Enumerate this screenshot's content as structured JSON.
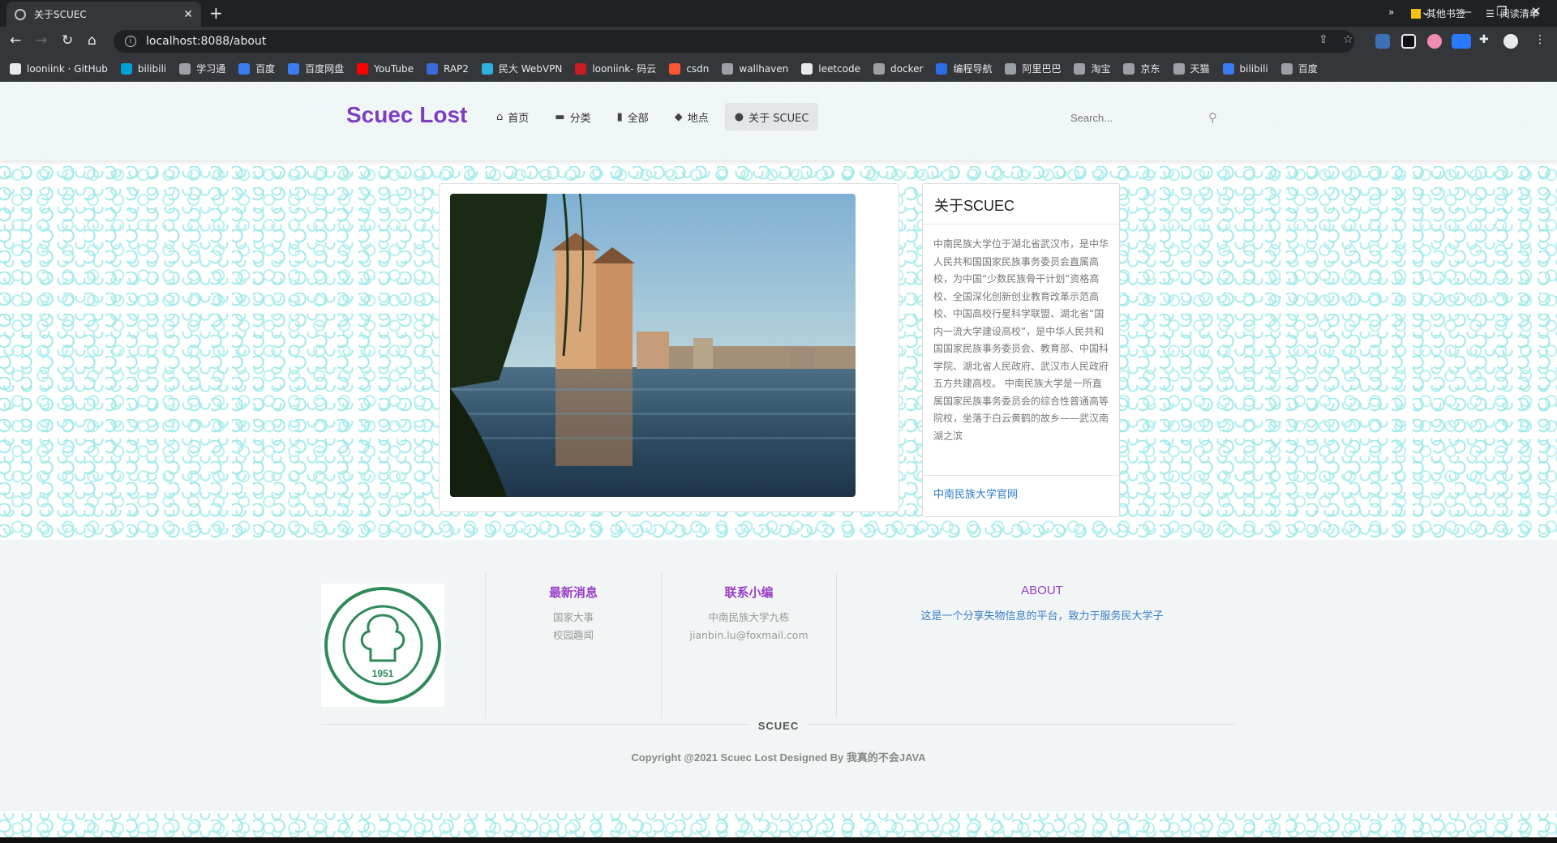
{
  "browser": {
    "tab_title": "关于SCUEC",
    "tab_close": "✕",
    "new_tab": "+",
    "url": "localhost:8088/about",
    "bookmarks": [
      {
        "label": "looniink · GitHub",
        "color": "#e8eaed"
      },
      {
        "label": "bilibili",
        "color": "#00a1d6"
      },
      {
        "label": "学习通",
        "color": "#9aa0a6"
      },
      {
        "label": "百度",
        "color": "#3b7cf0"
      },
      {
        "label": "百度网盘",
        "color": "#3b7cf0"
      },
      {
        "label": "YouTube",
        "color": "#ff0000"
      },
      {
        "label": "RAP2",
        "color": "#3b6ad9"
      },
      {
        "label": "民大 WebVPN",
        "color": "#2bb0e0"
      },
      {
        "label": "looniink- 码云",
        "color": "#c71d23"
      },
      {
        "label": "csdn",
        "color": "#fc5531"
      },
      {
        "label": "wallhaven",
        "color": "#9aa0a6"
      },
      {
        "label": "leetcode",
        "color": "#e8eaed"
      },
      {
        "label": "docker",
        "color": "#9aa0a6"
      },
      {
        "label": "编程导航",
        "color": "#2b6de6"
      },
      {
        "label": "阿里巴巴",
        "color": "#9aa0a6"
      },
      {
        "label": "淘宝",
        "color": "#9aa0a6"
      },
      {
        "label": "京东",
        "color": "#9aa0a6"
      },
      {
        "label": "天猫",
        "color": "#9aa0a6"
      },
      {
        "label": "bilibili",
        "color": "#3b7cf0"
      },
      {
        "label": "百度",
        "color": "#9aa0a6"
      }
    ],
    "more_bookmarks": "»",
    "other_bookmarks": "其他书签",
    "reading_list": "阅读清单"
  },
  "site": {
    "logo": "Scuec Lost",
    "nav": [
      {
        "icon": "⌂",
        "label": "首页"
      },
      {
        "icon": "▬",
        "label": "分类"
      },
      {
        "icon": "▮",
        "label": "全部"
      },
      {
        "icon": "◆",
        "label": "地点"
      },
      {
        "icon": "●",
        "label": "关于 SCUEC"
      }
    ],
    "search_placeholder": "Search..."
  },
  "about": {
    "title": "关于SCUEC",
    "body": "中南民族大学位于湖北省武汉市，是中华人民共和国国家民族事务委员会直属高校，为中国“少数民族骨干计划”资格高校、全国深化创新创业教育改革示范高校、中国高校行星科学联盟、湖北省“国内一流大学建设高校”，是中华人民共和国国家民族事务委员会、教育部、中国科学院、湖北省人民政府、武汉市人民政府五方共建高校。 中南民族大学是一所直属国家民族事务委员会的综合性普通高等院校，坐落于白云黄鹤的故乡——武汉南湖之滨",
    "link": "中南民族大学官网"
  },
  "footer": {
    "logo_year": "1951",
    "news": {
      "title": "最新消息",
      "items": [
        "国家大事",
        "校园趣闻"
      ]
    },
    "contact": {
      "title": "联系小编",
      "items": [
        "中南民族大学九栋",
        "jianbin.lu@foxmail.com"
      ]
    },
    "about": {
      "title": "ABOUT",
      "text": "这是一个分享失物信息的平台，致力于服务民大学子"
    },
    "brand": "SCUEC",
    "copyright": "Copyright @2021 Scuec Lost Designed By 我真的不会JAVA"
  }
}
